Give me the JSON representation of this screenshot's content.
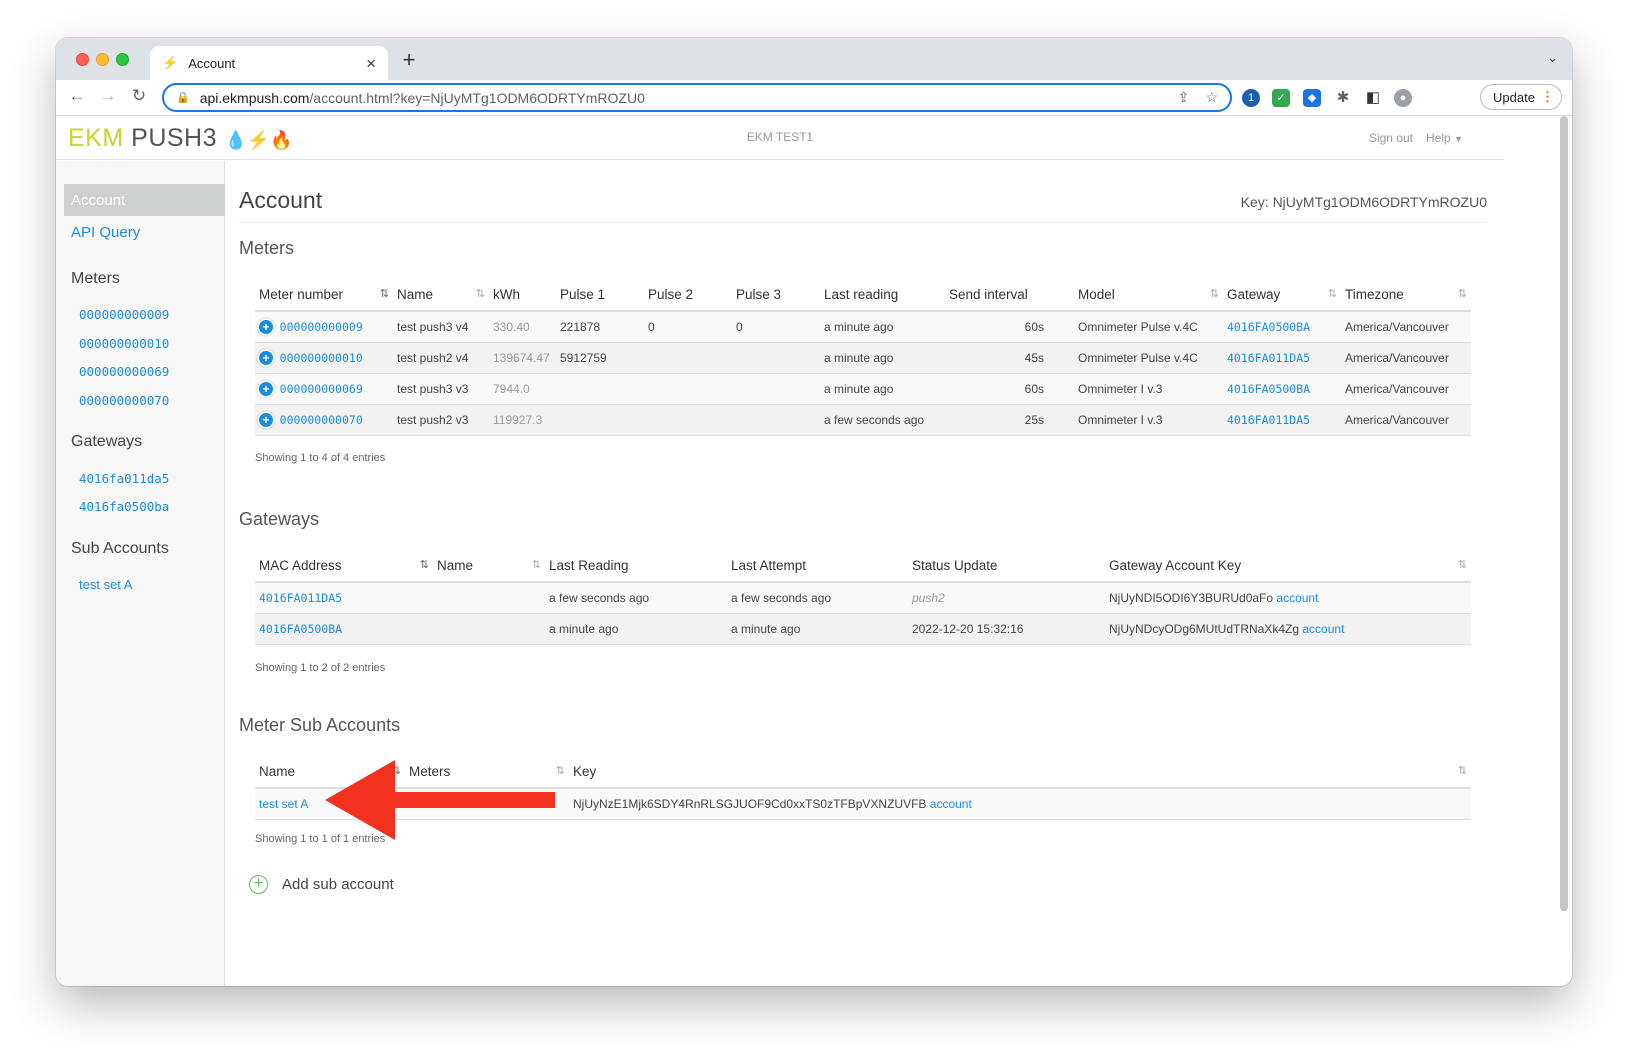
{
  "browser": {
    "tab_title": "Account",
    "url_host": "api.ekmpush.com",
    "url_path": "/account.html?key=NjUyMTg1ODM6ODRTYmROZU0",
    "update_label": "Update"
  },
  "header": {
    "brand_ekm": "EKM",
    "brand_push": "PUSH3",
    "account_name": "EKM TEST1",
    "sign_out": "Sign out",
    "help": "Help"
  },
  "sidebar": {
    "active": "Account",
    "api_query": "API Query",
    "meters_heading": "Meters",
    "meters": [
      "000000000009",
      "000000000010",
      "000000000069",
      "000000000070"
    ],
    "gateways_heading": "Gateways",
    "gateways": [
      "4016fa011da5",
      "4016fa0500ba"
    ],
    "subaccounts_heading": "Sub Accounts",
    "subaccounts": [
      "test set A"
    ]
  },
  "main": {
    "title": "Account",
    "key_line": "Key: NjUyMTg1ODM6ODRTYmROZU0",
    "meters_title": "Meters",
    "meters_columns": [
      "Meter number",
      "Name",
      "kWh",
      "Pulse 1",
      "Pulse 2",
      "Pulse 3",
      "Last reading",
      "Send interval",
      "Model",
      "Gateway",
      "Timezone"
    ],
    "meters_rows": [
      {
        "number": "000000000009",
        "name": "test push3 v4",
        "kwh": "330.40",
        "p1": "221878",
        "p2": "0",
        "p3": "0",
        "last": "a minute ago",
        "interval": "60s",
        "model": "Omnimeter Pulse v.4C",
        "gateway": "4016FA0500BA",
        "tz": "America/Vancouver"
      },
      {
        "number": "000000000010",
        "name": "test push2 v4",
        "kwh": "139674.47",
        "p1": "5912759",
        "p2": "",
        "p3": "",
        "last": "a minute ago",
        "interval": "45s",
        "model": "Omnimeter Pulse v.4C",
        "gateway": "4016FA011DA5",
        "tz": "America/Vancouver"
      },
      {
        "number": "000000000069",
        "name": "test push3 v3",
        "kwh": "7944.0",
        "p1": "",
        "p2": "",
        "p3": "",
        "last": "a minute ago",
        "interval": "60s",
        "model": "Omnimeter I v.3",
        "gateway": "4016FA0500BA",
        "tz": "America/Vancouver"
      },
      {
        "number": "000000000070",
        "name": "test push2 v3",
        "kwh": "119927.3",
        "p1": "",
        "p2": "",
        "p3": "",
        "last": "a few seconds ago",
        "interval": "25s",
        "model": "Omnimeter I v.3",
        "gateway": "4016FA011DA5",
        "tz": "America/Vancouver"
      }
    ],
    "meters_showing": "Showing 1 to 4 of 4 entries",
    "gateways_title": "Gateways",
    "gateways_columns": [
      "MAC Address",
      "Name",
      "Last Reading",
      "Last Attempt",
      "Status Update",
      "Gateway Account Key"
    ],
    "gateways_rows": [
      {
        "mac": "4016FA011DA5",
        "name": "",
        "last_reading": "a few seconds ago",
        "last_attempt": "a few seconds ago",
        "status": "push2",
        "key": "NjUyNDI5ODI6Y3BURUd0aFo",
        "link": "account"
      },
      {
        "mac": "4016FA0500BA",
        "name": "",
        "last_reading": "a minute ago",
        "last_attempt": "a minute ago",
        "status": "2022-12-20 15:32:16",
        "key": "NjUyNDcyODg6MUtUdTRNaXk4Zg",
        "link": "account"
      }
    ],
    "gateways_showing": "Showing 1 to 2 of 2 entries",
    "subaccounts_title": "Meter Sub Accounts",
    "subaccounts_columns": [
      "Name",
      "Meters",
      "Key"
    ],
    "subaccounts_rows": [
      {
        "name": "test set A",
        "meters": "",
        "key": "NjUyNzE1Mjk6SDY4RnRLSGJUOF9Cd0xxTS0zTFBpVXNZUVFB",
        "link": "account"
      }
    ],
    "subaccounts_showing": "Showing 1 to 1 of 1 entries",
    "add_sub": "Add sub account"
  },
  "annotation_color": "#f0321e"
}
